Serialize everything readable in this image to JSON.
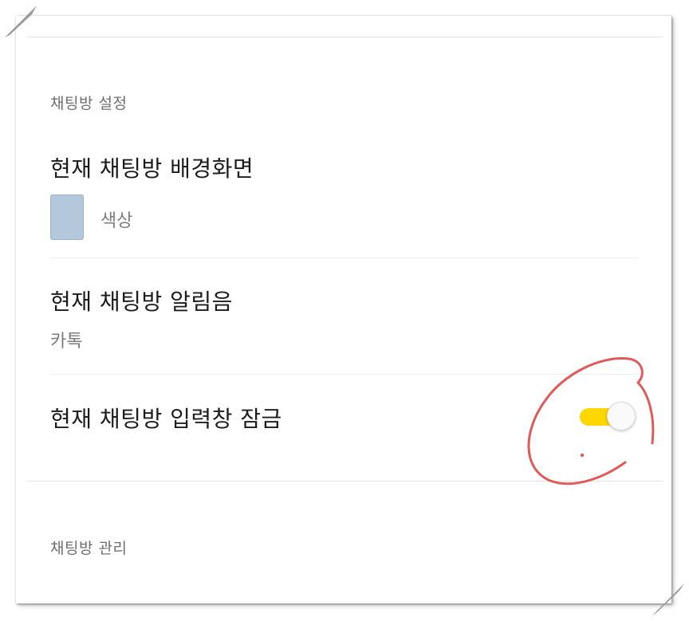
{
  "settings": {
    "chatroom_settings": {
      "section_title": "채팅방 설정",
      "background": {
        "title": "현재 채팅방 배경화면",
        "value_label": "색상",
        "swatch_color": "#b4c8dc"
      },
      "notification_sound": {
        "title": "현재 채팅방 알림음",
        "value": "카톡"
      },
      "input_lock": {
        "title": "현재 채팅방 입력창 잠금",
        "enabled": true,
        "track_color": "#fed600"
      }
    },
    "chatroom_management": {
      "section_title": "채팅방 관리"
    }
  },
  "annotation_color": "#e05a5a"
}
